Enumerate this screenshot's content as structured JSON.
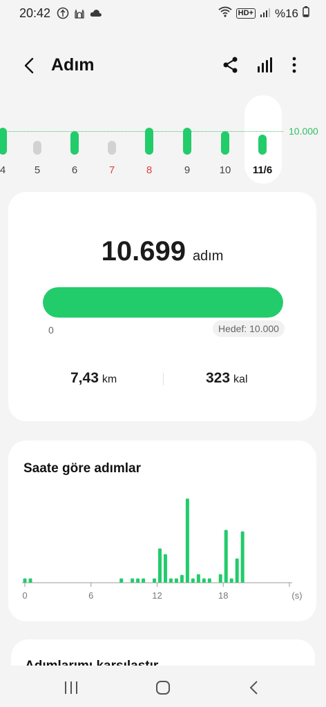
{
  "status_bar": {
    "time": "20:42",
    "left_icons": [
      "android-icon",
      "mosque-icon",
      "cloud-icon"
    ],
    "right_icons": [
      "wifi-icon",
      "hd-plus-icon",
      "signal-icon",
      "battery-icon"
    ],
    "hd_label": "HD+",
    "battery_text": "%16"
  },
  "header": {
    "title": "Adım",
    "icons": [
      "back-arrow-icon",
      "share-icon",
      "bar-chart-icon",
      "more-vertical-icon"
    ]
  },
  "day_strip": {
    "goal_label": "10.000",
    "days": [
      {
        "label": "4",
        "steps_ratio": 1.15,
        "met_goal": true,
        "weekend": false
      },
      {
        "label": "5",
        "steps_ratio": 0.45,
        "met_goal": false,
        "weekend": false
      },
      {
        "label": "6",
        "steps_ratio": 1.0,
        "met_goal": true,
        "weekend": false
      },
      {
        "label": "7",
        "steps_ratio": 0.35,
        "met_goal": false,
        "weekend": true
      },
      {
        "label": "8",
        "steps_ratio": 1.15,
        "met_goal": true,
        "weekend": true
      },
      {
        "label": "9",
        "steps_ratio": 1.15,
        "met_goal": true,
        "weekend": false
      },
      {
        "label": "10",
        "steps_ratio": 1.0,
        "met_goal": true,
        "weekend": false
      },
      {
        "label": "11/6",
        "steps_ratio": 0.85,
        "met_goal": true,
        "weekend": false,
        "selected": true
      }
    ]
  },
  "summary": {
    "steps": "10.699",
    "steps_unit": "adım",
    "progress_fraction": 1.0,
    "progress_start": "0",
    "goal_text": "Hedef: 10.000",
    "distance": "7,43",
    "distance_unit": "km",
    "calories": "323",
    "calories_unit": "kal"
  },
  "hourly": {
    "title": "Saate göre adımlar",
    "x_ticks": [
      "0",
      "6",
      "12",
      "18"
    ],
    "x_unit": "(s)"
  },
  "chart_data": {
    "type": "bar",
    "title": "Saate göre adımlar",
    "xlabel": "(s)",
    "ylabel": "",
    "x_range": [
      0,
      24
    ],
    "x_ticks": [
      0,
      6,
      12,
      18
    ],
    "grid": false,
    "color": "#22cc6b",
    "x": [
      0,
      0.5,
      8.75,
      9.75,
      10.25,
      10.75,
      11.75,
      12.25,
      12.75,
      13.25,
      13.75,
      14.25,
      14.75,
      15.25,
      15.75,
      16.25,
      16.75,
      17.75,
      18.25,
      18.75,
      19.25,
      19.75
    ],
    "values": [
      30,
      30,
      30,
      30,
      30,
      30,
      30,
      240,
      200,
      30,
      30,
      55,
      590,
      30,
      60,
      30,
      30,
      60,
      370,
      30,
      170,
      360
    ]
  },
  "compare": {
    "title": "Adımlarımı karşılaştır"
  },
  "nav_bar": {
    "icons": [
      "recent-apps-icon",
      "home-icon",
      "back-icon"
    ]
  },
  "colors": {
    "accent": "#22cc6b",
    "weekend": "#e0443c",
    "below_goal": "#d2d2d2",
    "background": "#f4f4f4",
    "card": "#ffffff"
  }
}
